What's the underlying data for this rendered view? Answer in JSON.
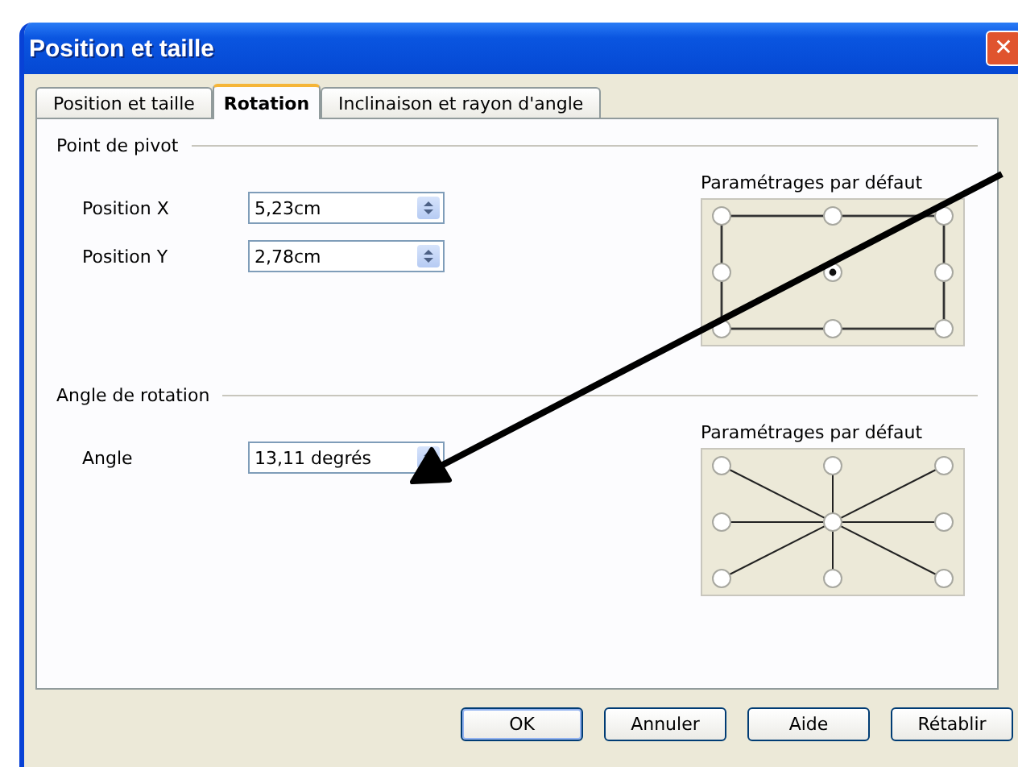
{
  "window": {
    "title": "Position et taille",
    "close": "✕"
  },
  "tabs": [
    {
      "label": "Position et taille",
      "selected": false
    },
    {
      "label": "Rotation",
      "selected": true
    },
    {
      "label": "Inclinaison et rayon d'angle",
      "selected": false
    }
  ],
  "sections": [
    {
      "title": "Point de pivot",
      "fields": [
        {
          "label": "Position X",
          "value": "5,23cm"
        },
        {
          "label": "Position Y",
          "value": "2,78cm"
        }
      ],
      "presets": {
        "label": "Paramétrages par défaut",
        "kind": "frame",
        "points": [
          {
            "selected": false
          },
          {
            "selected": false
          },
          {
            "selected": false
          },
          {
            "selected": false
          },
          {
            "selected": true
          },
          {
            "selected": false
          },
          {
            "selected": false
          },
          {
            "selected": false
          },
          {
            "selected": false
          }
        ]
      }
    },
    {
      "title": "Angle de rotation",
      "fields": [
        {
          "label": "Angle",
          "value": "13,11 degrés"
        }
      ],
      "presets": {
        "label": "Paramétrages par défaut",
        "kind": "star",
        "points": [
          {
            "selected": false
          },
          {
            "selected": false
          },
          {
            "selected": false
          },
          {
            "selected": false
          },
          {
            "selected": false
          },
          {
            "selected": false
          },
          {
            "selected": false
          },
          {
            "selected": false
          },
          {
            "selected": false
          }
        ]
      }
    }
  ],
  "buttons": [
    {
      "label": "OK",
      "default": true
    },
    {
      "label": "Annuler",
      "default": false
    },
    {
      "label": "Aide",
      "default": false
    },
    {
      "label": "Rétablir",
      "default": false
    }
  ],
  "annotation": {
    "kind": "arrow"
  }
}
